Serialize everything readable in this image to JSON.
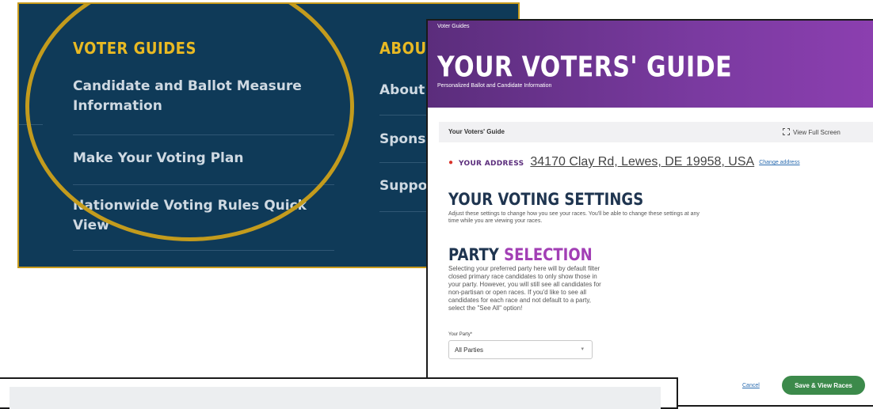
{
  "footer": {
    "voter_heading": "VOTER GUIDES",
    "about_heading": "ABOUT",
    "voter_links": [
      {
        "label": "Candidate and Ballot Measure Information"
      },
      {
        "label": "Make Your Voting Plan"
      },
      {
        "label": "Nationwide Voting Rules Quick View"
      }
    ],
    "about_links": [
      {
        "label": "About"
      },
      {
        "label": "Spons"
      },
      {
        "label": "Suppo"
      }
    ],
    "colors": {
      "background": "#0f3a58",
      "heading": "#e8b923",
      "highlight": "#c39b1d"
    }
  },
  "guide": {
    "breadcrumb": "Voter Guides",
    "title": "YOUR VOTERS' GUIDE",
    "subtitle": "Personalized Ballot and Candidate Information",
    "bar_title": "Your Voters' Guide",
    "full_screen_label": "View Full Screen",
    "address_label": "YOUR ADDRESS",
    "address_value": "34170 Clay Rd, Lewes, DE 19958, USA",
    "change_address": "Change address",
    "settings_title": "YOUR VOTING SETTINGS",
    "settings_desc": "Adjust these settings to change how you see your races. You'll be able to change these settings at any time while you are viewing your races.",
    "party_title_1": "PARTY",
    "party_title_2": "SELECTION",
    "party_desc": "Selecting your preferred party here will by default filter closed primary race candidates to only show those in your party. However, you will still see all candidates for non-partisan or open races. If you'd like to see all candidates for each race and not default to a party, select the \"See All\" option!",
    "party_label": "Your Party*",
    "party_value": "All Parties",
    "cancel_label": "Cancel",
    "save_label": "Save & View Races",
    "colors": {
      "hero": "#6a339a",
      "accent": "#a23fb5",
      "save": "#3c8a4b"
    }
  }
}
